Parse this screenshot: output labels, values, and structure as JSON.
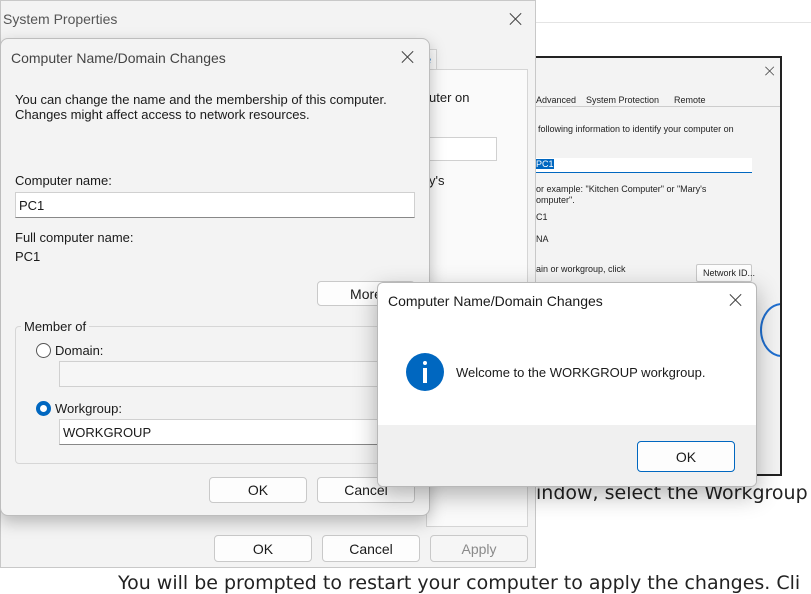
{
  "document": {
    "line1": "indow, select the Workgroup",
    "line2": "You will be prompted to restart your computer to apply the changes. Cli"
  },
  "embedded_screenshot": {
    "tabs": [
      "Advanced",
      "System Protection",
      "Remote"
    ],
    "text1": "following information to identify your computer on",
    "name_value": "PC1",
    "example": "or example: \"Kitchen Computer\" or \"Mary's",
    "example2": "omputer\".",
    "full_name": "C1",
    "workgroup": "NA",
    "domain_text": "ain or workgroup, click",
    "network_id_button": "Network ID..."
  },
  "system_properties": {
    "title": "System Properties",
    "partial_tab": "e",
    "partial_text1": "uter on",
    "partial_text2": "y's",
    "ok_label": "OK",
    "cancel_label": "Cancel",
    "apply_label": "Apply"
  },
  "name_dialog": {
    "title": "Computer Name/Domain Changes",
    "description": "You can change the name and the membership of this computer. Changes might affect access to network resources.",
    "computer_name_label": "Computer name:",
    "computer_name_value": "PC1",
    "full_name_label": "Full computer name:",
    "full_name_value": "PC1",
    "more_label": "More",
    "member_of_label": "Member of",
    "domain_label": "Domain:",
    "domain_value": "",
    "workgroup_label": "Workgroup:",
    "workgroup_value": "WORKGROUP",
    "selected_membership": "workgroup",
    "ok_label": "OK",
    "cancel_label": "Cancel"
  },
  "welcome_dialog": {
    "title": "Computer Name/Domain Changes",
    "message": "Welcome to the WORKGROUP workgroup.",
    "icon": "info-icon",
    "icon_color": "#0067c0",
    "ok_label": "OK"
  }
}
